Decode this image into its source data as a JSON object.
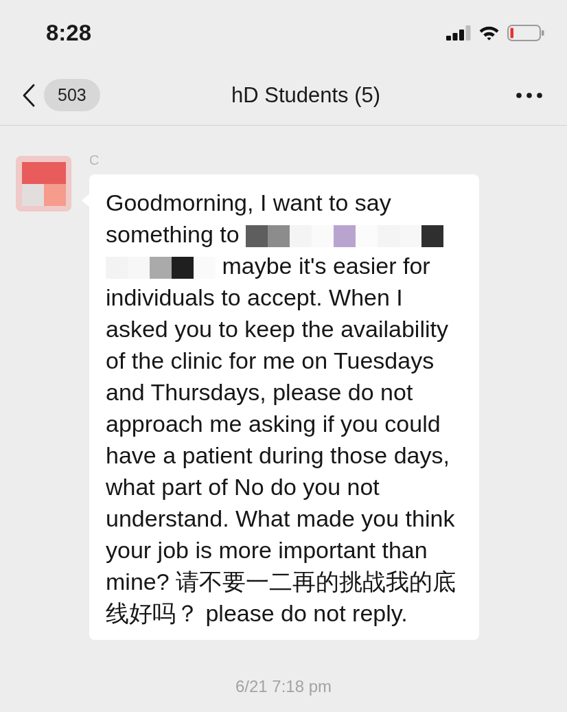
{
  "status_bar": {
    "time": "8:28"
  },
  "header": {
    "unread_count": "503",
    "title": "hD Students (5)"
  },
  "message": {
    "sender": "C",
    "segments": [
      {
        "kind": "text",
        "text": "Goodmorning, I want to say"
      },
      {
        "kind": "text",
        "text": "something to"
      },
      {
        "kind": "redaction"
      },
      {
        "kind": "redaction"
      },
      {
        "kind": "text",
        "text": "maybe it's easier for"
      },
      {
        "kind": "text",
        "text": "individuals to accept. When I asked you to keep the availability of the clinic for me on Tuesdays and Thursdays, please do not approach me asking if you could have a patient during those days, what part of No do you not understand. What made you think your job is more important than mine? 请不要一二再的挑战我的底线好吗？ please do not reply."
      }
    ]
  },
  "timestamp": "6/21 7:18 pm"
}
